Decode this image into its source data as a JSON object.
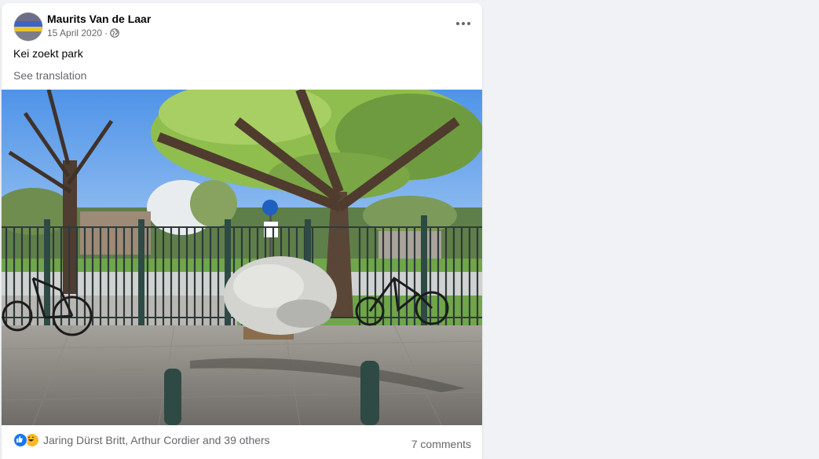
{
  "post": {
    "author": "Maurits Van de Laar",
    "date": "15 April 2020",
    "separator": "·",
    "audience_icon": "globe-icon",
    "caption": "Kei zoekt park",
    "see_translation": "See translation",
    "photo_description_icon": "photo",
    "reactions": {
      "icons": [
        "like-icon",
        "haha-icon"
      ],
      "names": "Jaring Dürst Britt, Arthur Cordier and 39 others"
    },
    "comments": "7 comments"
  },
  "colors": {
    "background": "#f0f2f5",
    "card": "#ffffff",
    "primary_text": "#050505",
    "secondary_text": "#65676b",
    "like_blue": "#1877f2",
    "haha_yellow": "#f7b928"
  }
}
